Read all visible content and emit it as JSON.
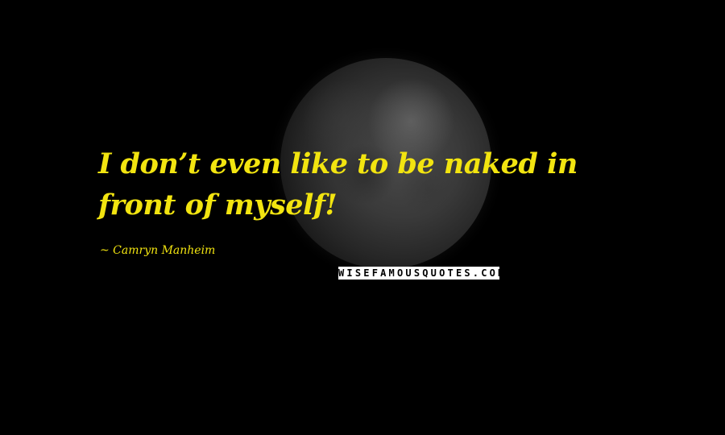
{
  "quote": {
    "text": "I don’t even like to be naked in front of myself!"
  },
  "author": {
    "text": "~ Camryn Manheim"
  },
  "watermark": {
    "text": "WISEFAMOUSQUOTES.COM"
  },
  "colors": {
    "background": "#000000",
    "text_accent": "#f2e410",
    "watermark_bg": "#ffffff",
    "watermark_fg": "#000000"
  },
  "image": {
    "subject": "moon"
  }
}
